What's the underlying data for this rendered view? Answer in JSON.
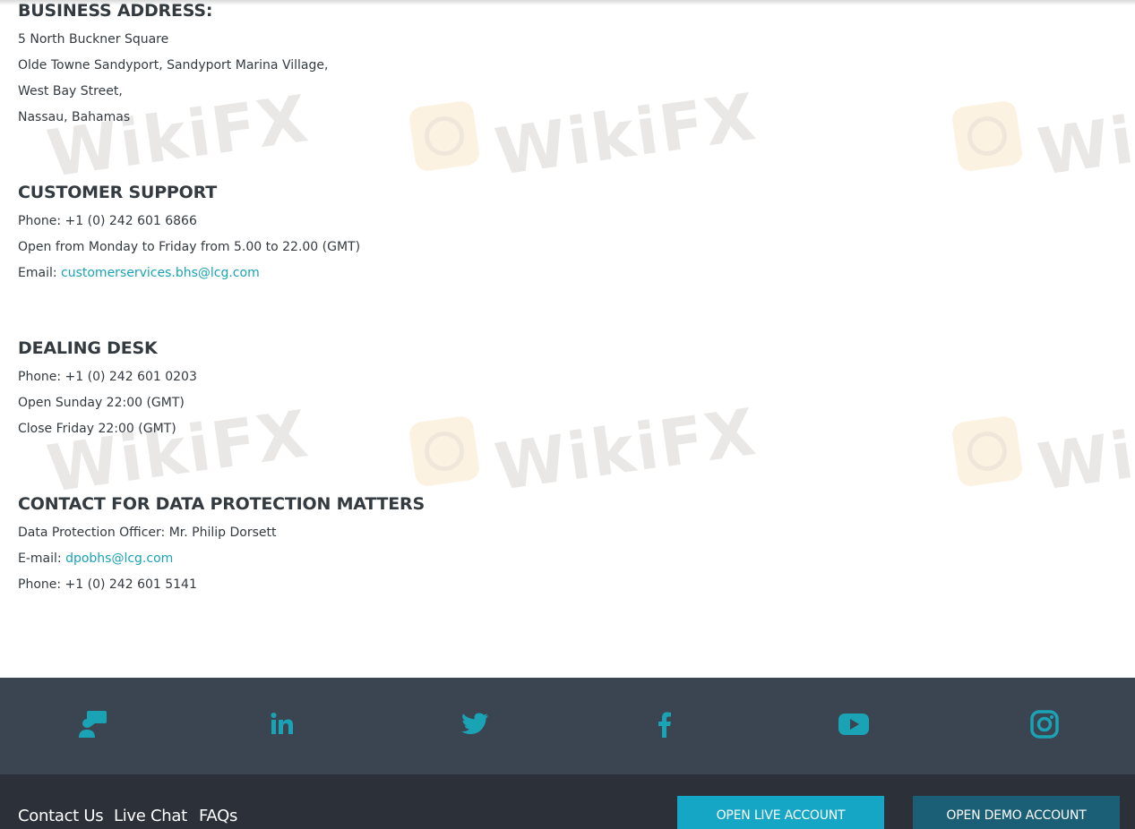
{
  "sections": [
    {
      "title": "BUSINESS ADDRESS:",
      "lines": [
        {
          "text": "5 North Buckner Square"
        },
        {
          "text": "Olde Towne Sandyport, Sandyport Marina Village,"
        },
        {
          "text": "West Bay Street,"
        },
        {
          "text": "Nassau, Bahamas"
        }
      ]
    },
    {
      "title": "CUSTOMER SUPPORT",
      "lines": [
        {
          "text": "Phone: +1 (0) 242 601 6866"
        },
        {
          "text": "Open from Monday to Friday from 5.00 to 22.00 (GMT)"
        },
        {
          "text": "Email: ",
          "link": "customerservices.bhs@lcg.com"
        }
      ]
    },
    {
      "title": "DEALING DESK",
      "lines": [
        {
          "text": "Phone: +1 (0) 242 601 0203"
        },
        {
          "text": "Open Sunday 22:00 (GMT)"
        },
        {
          "text": "Close Friday 22:00 (GMT)"
        }
      ]
    },
    {
      "title": "CONTACT FOR DATA PROTECTION MATTERS",
      "lines": [
        {
          "text": "Data Protection Officer: Mr. Philip Dorsett"
        },
        {
          "text": "E-mail: ",
          "link": "dpobhs@lcg.com"
        },
        {
          "text": "Phone: +1 (0) 242 601 5141"
        }
      ]
    }
  ],
  "watermark": {
    "text": "WikiFX"
  },
  "social_icons": [
    "chat-icon",
    "linkedin-icon",
    "twitter-icon",
    "facebook-icon",
    "youtube-icon",
    "instagram-icon"
  ],
  "footer": {
    "links": [
      "Contact Us",
      "Live Chat",
      "FAQs"
    ],
    "open_live_label": "OPEN LIVE ACCOUNT",
    "open_demo_label": "OPEN DEMO ACCOUNT"
  },
  "colors": {
    "accent": "#1aa3b5",
    "social_bar": "#3b4451",
    "bottom_bar": "#2b3039",
    "live_button": "#14a6c4",
    "demo_button": "#1b5f77"
  }
}
